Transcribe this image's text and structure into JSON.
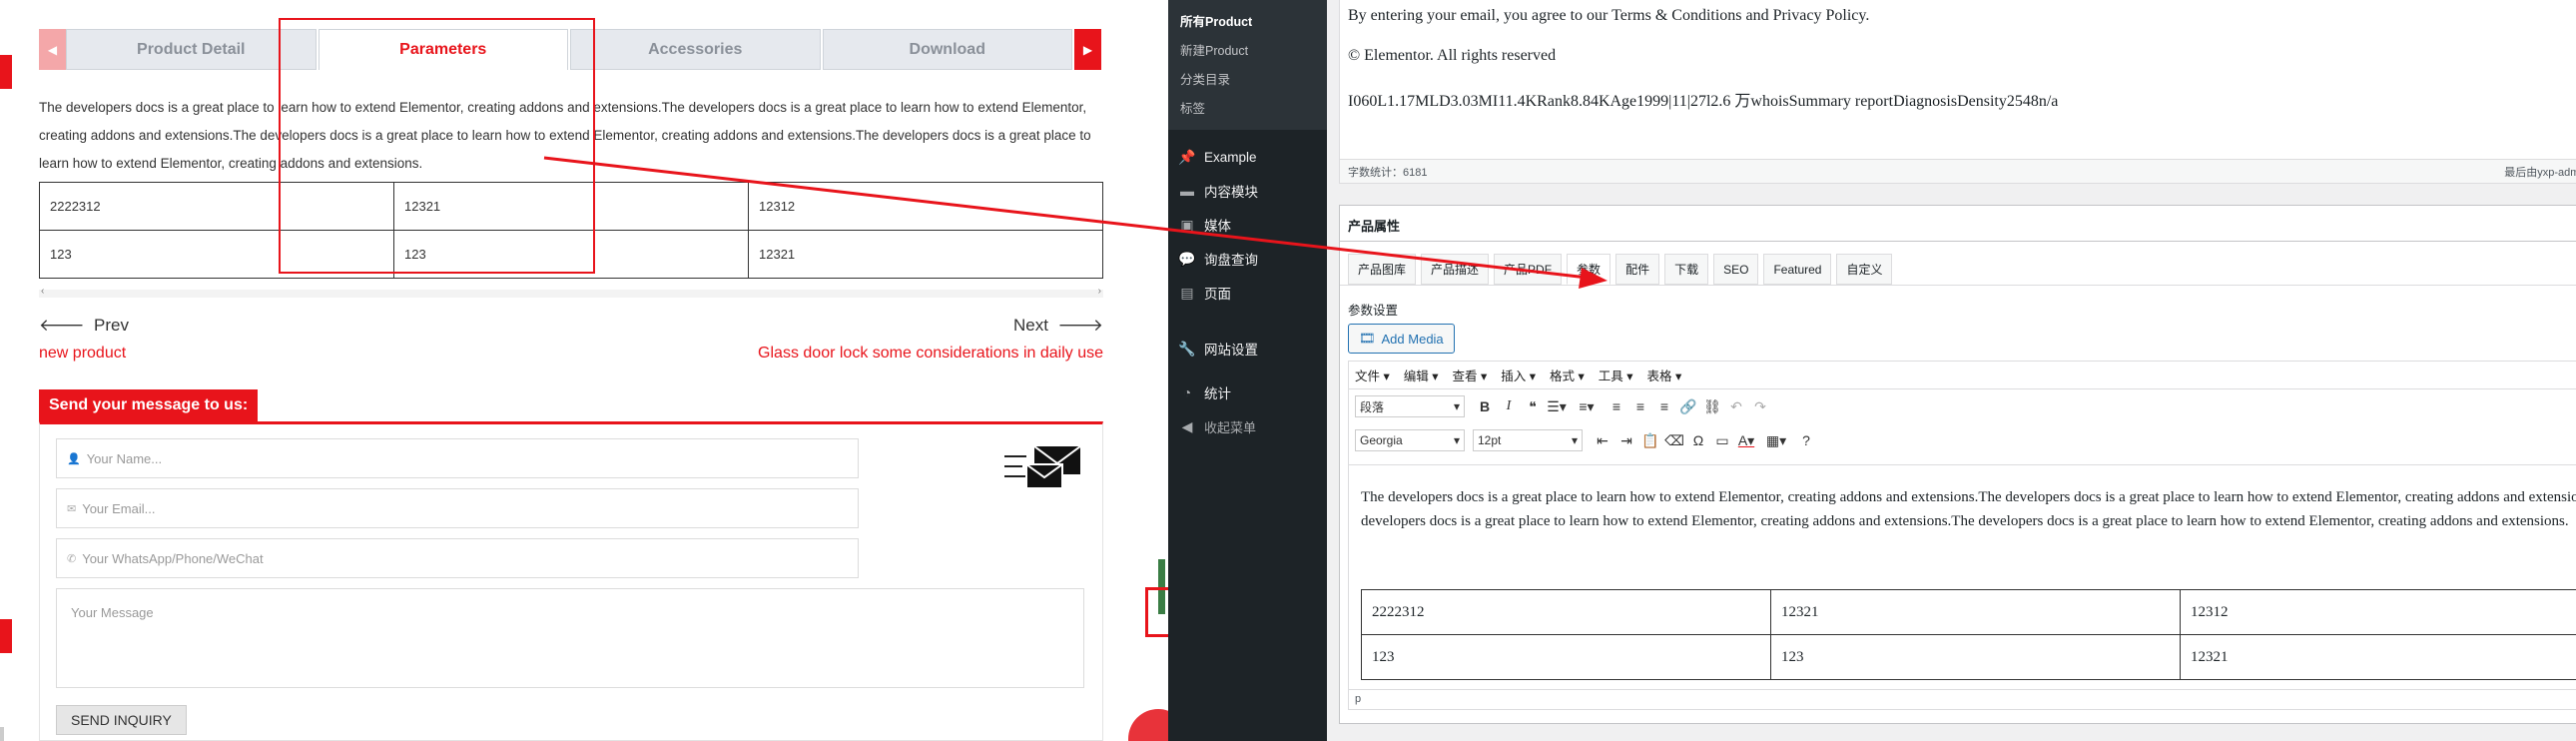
{
  "front": {
    "tabs": [
      "Product Detail",
      "Parameters",
      "Accessories",
      "Download"
    ],
    "arrow_left": "◀",
    "arrow_right": "▶",
    "paragraph": "The developers docs is a great place to learn how to extend Elementor, creating addons and extensions.The developers docs is a great place to learn how to extend Elementor, creating addons and extensions.The developers docs is a great place to learn how to extend Elementor, creating addons and extensions.The developers docs is a great place to learn how to extend Elementor, creating addons and extensions.",
    "table": [
      [
        "2222312",
        "12321",
        "12312"
      ],
      [
        "123",
        "123",
        "12321"
      ]
    ],
    "prev_label": "Prev",
    "next_label": "Next",
    "prev_link": "new product",
    "next_link": "Glass door lock some considerations in daily use",
    "send_title": "Send your message to us:",
    "name_placeholder": "Your Name...",
    "email_placeholder": "Your Email...",
    "phone_placeholder": "Your WhatsApp/Phone/WeChat",
    "message_placeholder": "Your Message",
    "submit_label": "SEND INQUIRY",
    "accent_color": "#e8141b"
  },
  "admin": {
    "submenu": [
      "所有Product",
      "新建Product",
      "分类目录",
      "标签"
    ],
    "menu": [
      {
        "icon": "pin-icon",
        "label": "Example"
      },
      {
        "icon": "module-icon",
        "label": "内容模块"
      },
      {
        "icon": "media-icon",
        "label": "媒体"
      },
      {
        "icon": "comment-icon",
        "label": "询盘查询"
      },
      {
        "icon": "page-icon",
        "label": "页面"
      }
    ],
    "menu2": [
      {
        "icon": "wrench-icon",
        "label": "网站设置"
      },
      {
        "icon": "chart-icon",
        "label": "统计"
      },
      {
        "icon": "collapse-icon",
        "label": "收起菜单"
      }
    ],
    "top_text_1": "By entering your email, you agree to our Terms & Conditions and Privacy Policy.",
    "top_text_2": "© Elementor. All rights reserved",
    "top_text_3": "I060L1.17MLD3.03MI11.4KRank8.84KAge1999|11|27l2.6 万whoisSummary reportDiagnosisDensity2548n/a",
    "word_count": "字数统计：6181",
    "last_edit": "最后由yxp-admin",
    "attr_title": "产品属性",
    "product_tabs": [
      "产品图库",
      "产品描述",
      "产品PDF",
      "参数",
      "配件",
      "下载",
      "SEO",
      "Featured",
      "自定义"
    ],
    "param_label": "参数设置",
    "add_media": "Add Media",
    "editor_menu": [
      "文件 ▾",
      "编辑 ▾",
      "查看 ▾",
      "插入 ▾",
      "格式 ▾",
      "工具 ▾",
      "表格 ▾"
    ],
    "format_select": "段落",
    "font_select": "Georgia",
    "size_select": "12pt",
    "editor_text": "The developers docs is a great place to learn how to extend Elementor, creating addons and extensions.The developers docs is a great place to learn how to extend Elementor, creating addons and extensions.The developers docs is a great place to learn how to extend Elementor, creating addons and extensions.The developers docs is a great place to learn how to extend Elementor, creating addons and extensions.",
    "editor_table": [
      [
        "2222312",
        "12321",
        "12312"
      ],
      [
        "123",
        "123",
        "12321"
      ]
    ],
    "editor_status": "p"
  }
}
